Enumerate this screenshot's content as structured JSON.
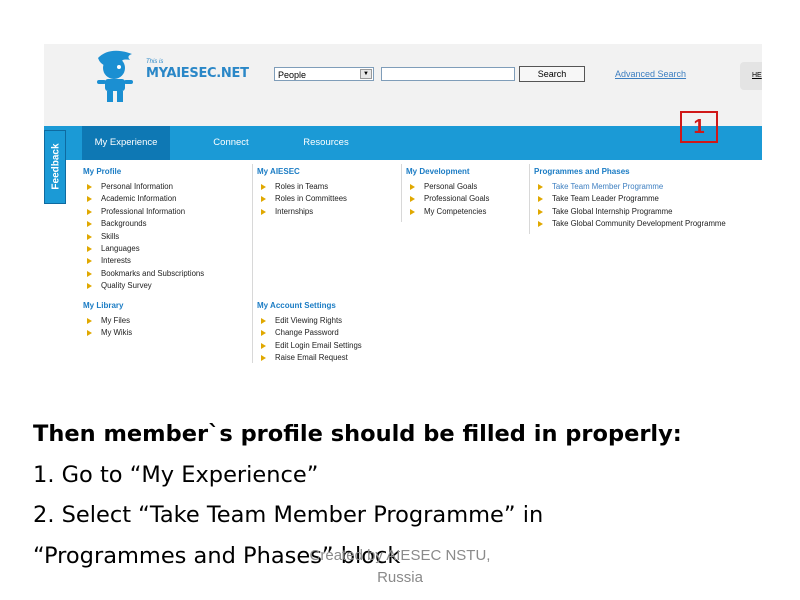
{
  "app": {
    "logo_small": "This is",
    "logo_text": "MYAIESEC.NET"
  },
  "search": {
    "scope_value": "People",
    "input_value": "",
    "button_label": "Search",
    "advanced_label": "Advanced Search",
    "help_label": "HE"
  },
  "nav": {
    "items": [
      {
        "label": "My Experience"
      },
      {
        "label": "Connect"
      },
      {
        "label": "Resources"
      }
    ]
  },
  "feedback_label": "Feedback",
  "marker_label": "1",
  "menu": {
    "my_profile": {
      "title": "My Profile",
      "items": [
        "Personal Information",
        "Academic Information",
        "Professional Information",
        "Backgrounds",
        "Skills",
        "Languages",
        "Interests",
        "Bookmarks and Subscriptions",
        "Quality Survey"
      ]
    },
    "my_aiesec": {
      "title": "My AIESEC",
      "items": [
        "Roles in Teams",
        "Roles in Committees",
        "Internships"
      ]
    },
    "my_development": {
      "title": "My Development",
      "items": [
        "Personal Goals",
        "Professional Goals",
        "My Competencies"
      ]
    },
    "programmes": {
      "title": "Programmes and Phases",
      "items": [
        "Take Team Member Programme",
        "Take Team Leader Programme",
        "Take Global Internship Programme",
        "Take Global Community Development Programme"
      ]
    },
    "my_library": {
      "title": "My Library",
      "items": [
        "My Files",
        "My Wikis"
      ]
    },
    "account_settings": {
      "title": "My Account Settings",
      "items": [
        "Edit Viewing Rights",
        "Change Password",
        "Edit Login Email Settings",
        "Raise Email Request"
      ]
    }
  },
  "instructions": {
    "heading": "Then member`s profile should be filled in properly:",
    "step1": "1.  Go to “My Experience”",
    "step2": "2. Select “Take Team Member Programme” in",
    "step3": "“Programmes and Phases” block"
  },
  "footer": {
    "line1": "Created by AIESEC NSTU,",
    "line2": "Russia"
  },
  "colors": {
    "nav_blue": "#1b9ad6",
    "nav_active": "#0e78b4",
    "link_blue": "#3d7fc1",
    "marker_red": "#d01818",
    "bullet_yellow": "#e0a800"
  }
}
